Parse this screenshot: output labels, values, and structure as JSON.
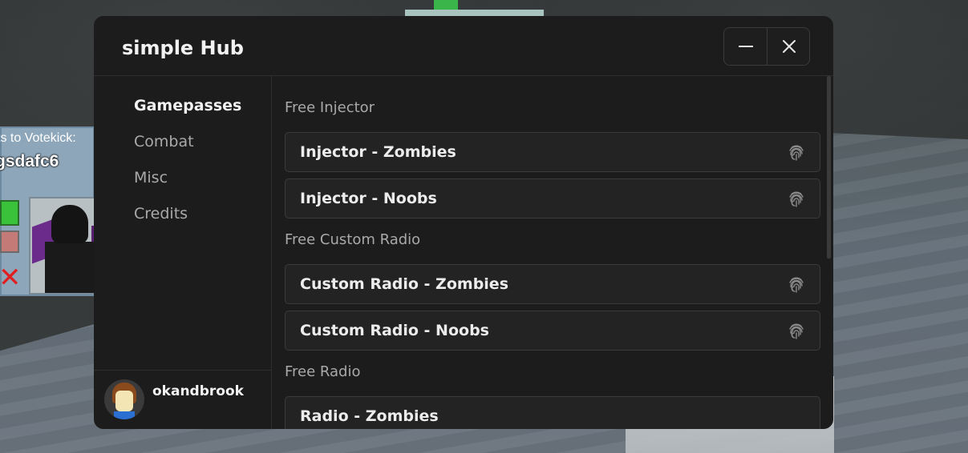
{
  "window": {
    "title": "simple Hub",
    "minimize_icon": "minus-icon",
    "close_icon": "close-icon"
  },
  "sidebar": {
    "items": [
      {
        "label": "Gamepasses",
        "active": true
      },
      {
        "label": "Combat",
        "active": false
      },
      {
        "label": "Misc",
        "active": false
      },
      {
        "label": "Credits",
        "active": false
      }
    ],
    "user": {
      "name": "okandbrook"
    }
  },
  "content": {
    "sections": [
      {
        "title": "Free Injector",
        "buttons": [
          "Injector - Zombies",
          "Injector - Noobs"
        ]
      },
      {
        "title": "Free Custom Radio",
        "buttons": [
          "Custom Radio - Zombies",
          "Custom Radio - Noobs"
        ]
      },
      {
        "title": "Free Radio",
        "buttons": [
          "Radio - Zombies"
        ]
      }
    ],
    "button_icon": "fingerprint-icon"
  },
  "background": {
    "votekick_label": "ts to Votekick:",
    "votekick_name": "gsdafc6"
  },
  "colors": {
    "window_bg": "#1c1c1c",
    "button_bg": "#232323",
    "text_primary": "#f2f2f2",
    "text_secondary": "#a9a9a9"
  }
}
